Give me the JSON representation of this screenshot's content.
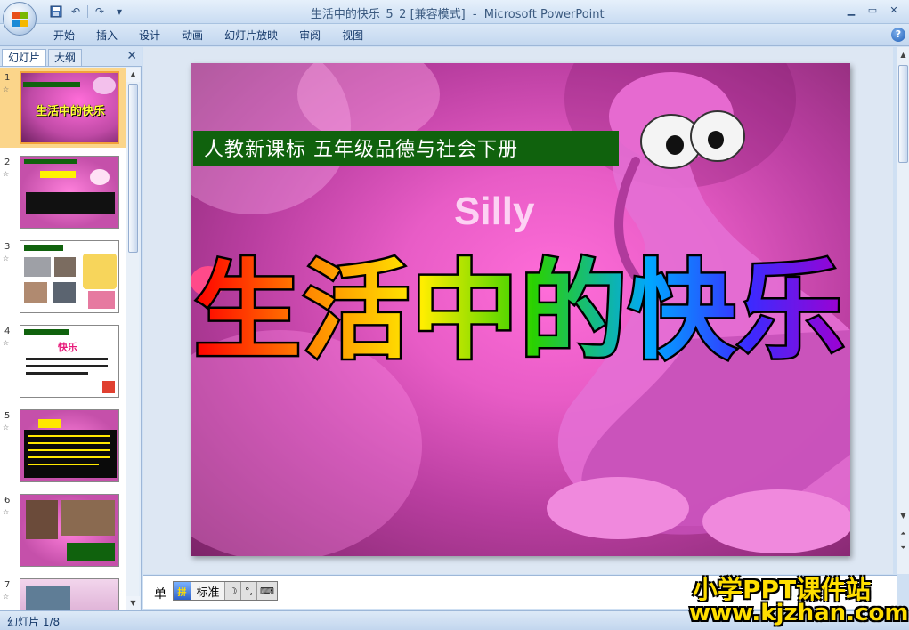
{
  "window": {
    "title_file": "_生活中的快乐_5_2",
    "title_mode": "[兼容模式]",
    "title_sep": "-",
    "app_name": "Microsoft PowerPoint",
    "controls": [
      "▁",
      "▭",
      "✕"
    ]
  },
  "quick_access": {
    "undo": "↶",
    "redo": "↷",
    "more": "▾"
  },
  "ribbon": {
    "tabs": [
      "开始",
      "插入",
      "设计",
      "动画",
      "幻灯片放映",
      "审阅",
      "视图"
    ],
    "help": "?"
  },
  "left_pane": {
    "tab_slides": "幻灯片",
    "tab_outline": "大纲",
    "close": "✕",
    "thumbnails": [
      {
        "num": "1",
        "star": "☆",
        "title": "生活中的快乐"
      },
      {
        "num": "2",
        "star": "☆",
        "title": ""
      },
      {
        "num": "3",
        "star": "☆",
        "title": ""
      },
      {
        "num": "4",
        "star": "☆",
        "title": "快乐"
      },
      {
        "num": "5",
        "star": "☆",
        "title": ""
      },
      {
        "num": "6",
        "star": "☆",
        "title": ""
      },
      {
        "num": "7",
        "star": "☆",
        "title": ""
      }
    ]
  },
  "slide": {
    "banner": "人教新课标 五年级品德与社会下册",
    "bg_word": "Silly",
    "title": "生活中的快乐"
  },
  "notes": {
    "label": "单"
  },
  "ime": {
    "logo": "拼",
    "mode": "标准",
    "moon": "☽",
    "punct": "°,",
    "keyboard": "⌨"
  },
  "statusbar": {
    "slide_info": "幻灯片 1/8"
  },
  "watermark": {
    "line1": "小学PPT课件站",
    "line2": "www.kjzhan.com"
  },
  "colors": {
    "accent": "#15396a",
    "slide_banner": "#10620d",
    "slide_bg": "#e85cc6",
    "watermark": "#ffde00"
  }
}
